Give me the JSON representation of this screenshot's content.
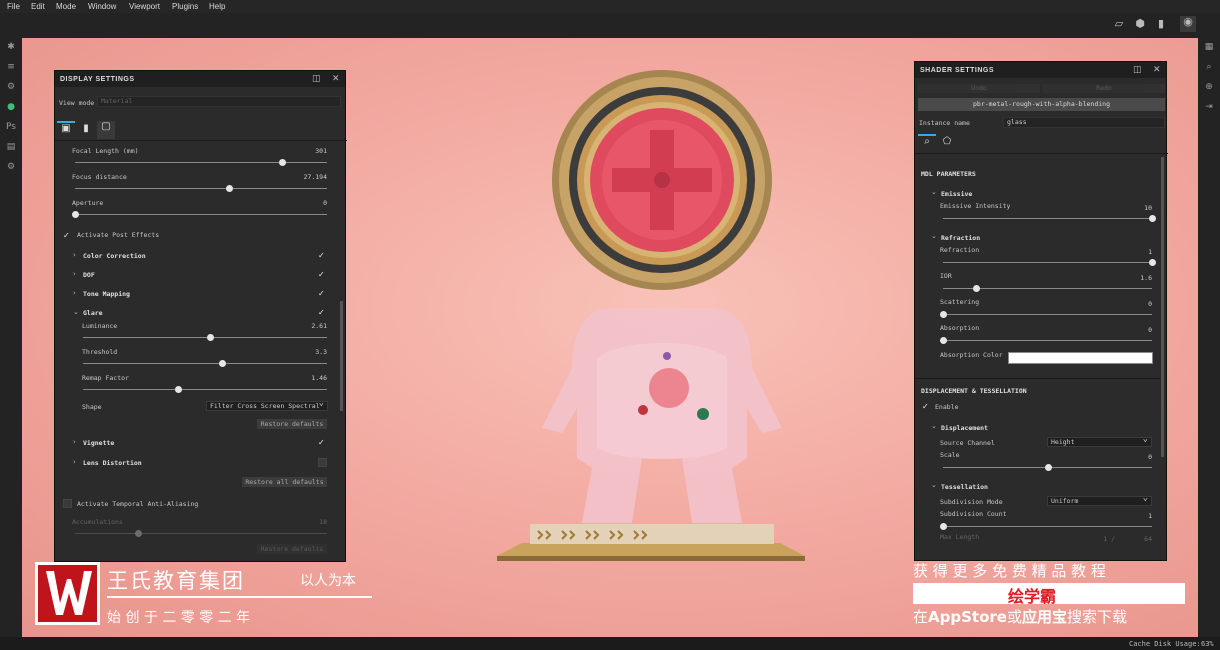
{
  "menu": [
    "File",
    "Edit",
    "Mode",
    "Window",
    "Viewport",
    "Plugins",
    "Help"
  ],
  "status": {
    "cache_label": "Cache Disk Usage:",
    "cache_value": "63%"
  },
  "display": {
    "title": "DISPLAY SETTINGS",
    "view_mode_label": "View mode",
    "view_mode_value": "Material",
    "focal_label": "Focal Length (mm)",
    "focal_value": "301",
    "focal_frac": 0.82,
    "focus_label": "Focus distance",
    "focus_value": "27.194",
    "focus_frac": 0.61,
    "aperture_label": "Aperture",
    "aperture_value": "0",
    "aperture_frac": 0.0,
    "activate_post": "Activate Post Effects",
    "color_correction": "Color Correction",
    "dof": "DOF",
    "tone_mapping": "Tone Mapping",
    "glare": "Glare",
    "luminance_label": "Luminance",
    "luminance_value": "2.61",
    "luminance_frac": 0.52,
    "threshold_label": "Threshold",
    "threshold_value": "3.3",
    "threshold_frac": 0.57,
    "remap_label": "Remap Factor",
    "remap_value": "1.46",
    "remap_frac": 0.39,
    "shape_label": "Shape",
    "shape_value": "Filter Cross Screen Spectral",
    "restore_defaults": "Restore defaults",
    "vignette": "Vignette",
    "lens_distortion": "Lens Distortion",
    "restore_all": "Restore all defaults",
    "taa": "Activate Temporal Anti-Aliasing",
    "accum_label": "Accumulations",
    "accum_value": "18",
    "accum_frac": 0.25,
    "restore_defaults2": "Restore defaults"
  },
  "shader": {
    "title": "SHADER SETTINGS",
    "undo": "Undo",
    "redo": "Redo",
    "shader_name": "pbr-metal-rough-with-alpha-blending",
    "instance_label": "Instance name",
    "instance_value": "glass",
    "mdl": "MDL PARAMETERS",
    "emissive": "Emissive",
    "emissive_int_label": "Emissive Intensity",
    "emissive_int_value": "10",
    "emissive_int_frac": 1.0,
    "refraction": "Refraction",
    "refraction_label": "Refraction",
    "refraction_value": "1",
    "refraction_frac": 1.0,
    "ior_label": "IOR",
    "ior_value": "1.6",
    "ior_frac": 0.16,
    "scattering_label": "Scattering",
    "scattering_value": "0",
    "scattering_frac": 0.0,
    "absorption_label": "Absorption",
    "absorption_value": "0",
    "absorption_frac": 0.0,
    "absorption_color_label": "Absorption Color",
    "disp_tess": "DISPLACEMENT & TESSELLATION",
    "enable": "Enable",
    "displacement": "Displacement",
    "source_label": "Source Channel",
    "source_value": "Height",
    "scale_label": "Scale",
    "scale_value": "0",
    "scale_frac": 0.5,
    "tessellation": "Tessellation",
    "subdiv_mode_label": "Subdivision Mode",
    "subdiv_mode_value": "Uniform",
    "subdiv_count_label": "Subdivision Count",
    "subdiv_count_value": "1",
    "subdiv_count_frac": 0.0,
    "max_length_label": "Max Length",
    "max_length_value": "64",
    "max_length_pre": "1 /"
  },
  "watermark": {
    "company": "王氏教育集团",
    "motto": "以人为本",
    "founded": "始 创 于 二 零 零 二 年",
    "get_more": "获 得 更 多 免 费 精 品 教 程",
    "app": "绘学霸",
    "download_pre": "在",
    "download_store1": "AppStore",
    "download_mid": "或",
    "download_store2": "应用宝",
    "download_post": "搜索下载"
  },
  "colors": {
    "viewport": "#f3aba2",
    "panel": "#2b2b2b",
    "logo": "#c0141c"
  }
}
